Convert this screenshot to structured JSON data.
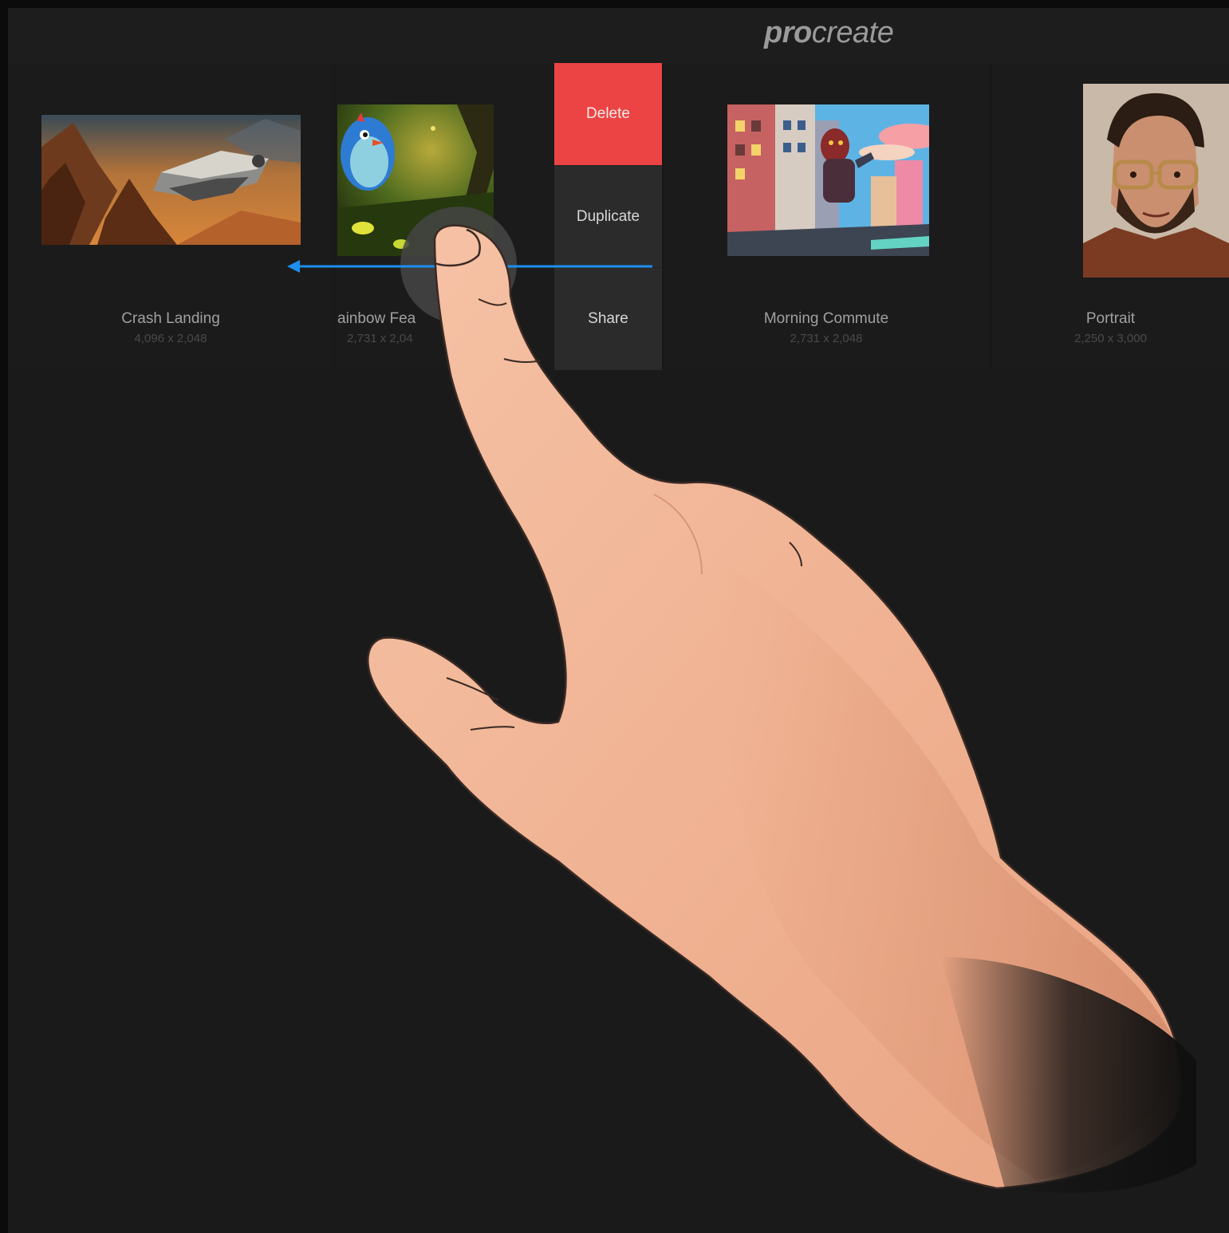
{
  "app": {
    "logo_pro": "pro",
    "logo_create": "create"
  },
  "gallery": {
    "artworks": [
      {
        "title": "Crash Landing",
        "size": "4,096 x 2,048"
      },
      {
        "title": "ainbow Fea",
        "size": "2,731 x 2,04"
      },
      {
        "title": "Morning Commute",
        "size": "2,731 x 2,048"
      },
      {
        "title": "Portrait",
        "size": "2,250 x 3,000"
      }
    ]
  },
  "action_menu": {
    "delete_label": "Delete",
    "duplicate_label": "Duplicate",
    "share_label": "Share"
  },
  "gesture": {
    "direction": "swipe-left",
    "arrow_color": "#1e8ef0",
    "touch_indicator_color": "#4a4a4a"
  },
  "colors": {
    "background": "#1a1a1a",
    "delete": "#ec4444",
    "menu": "#2b2b2b",
    "skin": "#f0b79b"
  }
}
